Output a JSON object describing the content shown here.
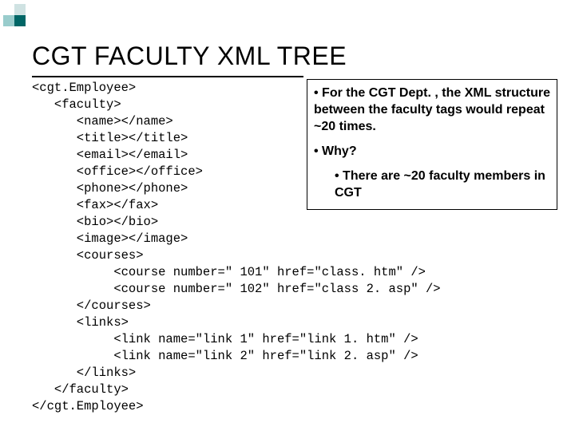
{
  "title": "CGT FACULTY XML TREE",
  "xml": {
    "l01": "<cgt.Employee>",
    "l02": "   <faculty>",
    "l03": "      <name></name>",
    "l04": "      <title></title>",
    "l05": "      <email></email>",
    "l06": "      <office></office>",
    "l07": "      <phone></phone>",
    "l08": "      <fax></fax>",
    "l09": "      <bio></bio>",
    "l10": "      <image></image>",
    "l11": "      <courses>",
    "l12": "           <course number=\" 101\" href=\"class. htm\" />",
    "l13": "           <course number=\" 102\" href=\"class 2. asp\" />",
    "l14": "      </courses>",
    "l15": "      <links>",
    "l16": "           <link name=\"link 1\" href=\"link 1. htm\" />",
    "l17": "           <link name=\"link 2\" href=\"link 2. asp\" />",
    "l18": "      </links>",
    "l19": "   </faculty>",
    "l20": "</cgt.Employee>"
  },
  "note": {
    "p1": "• For the CGT Dept. , the XML structure between the faculty tags would repeat ~20 times.",
    "p2": "• Why?",
    "p3": "• There are ~20 faculty members in CGT"
  }
}
